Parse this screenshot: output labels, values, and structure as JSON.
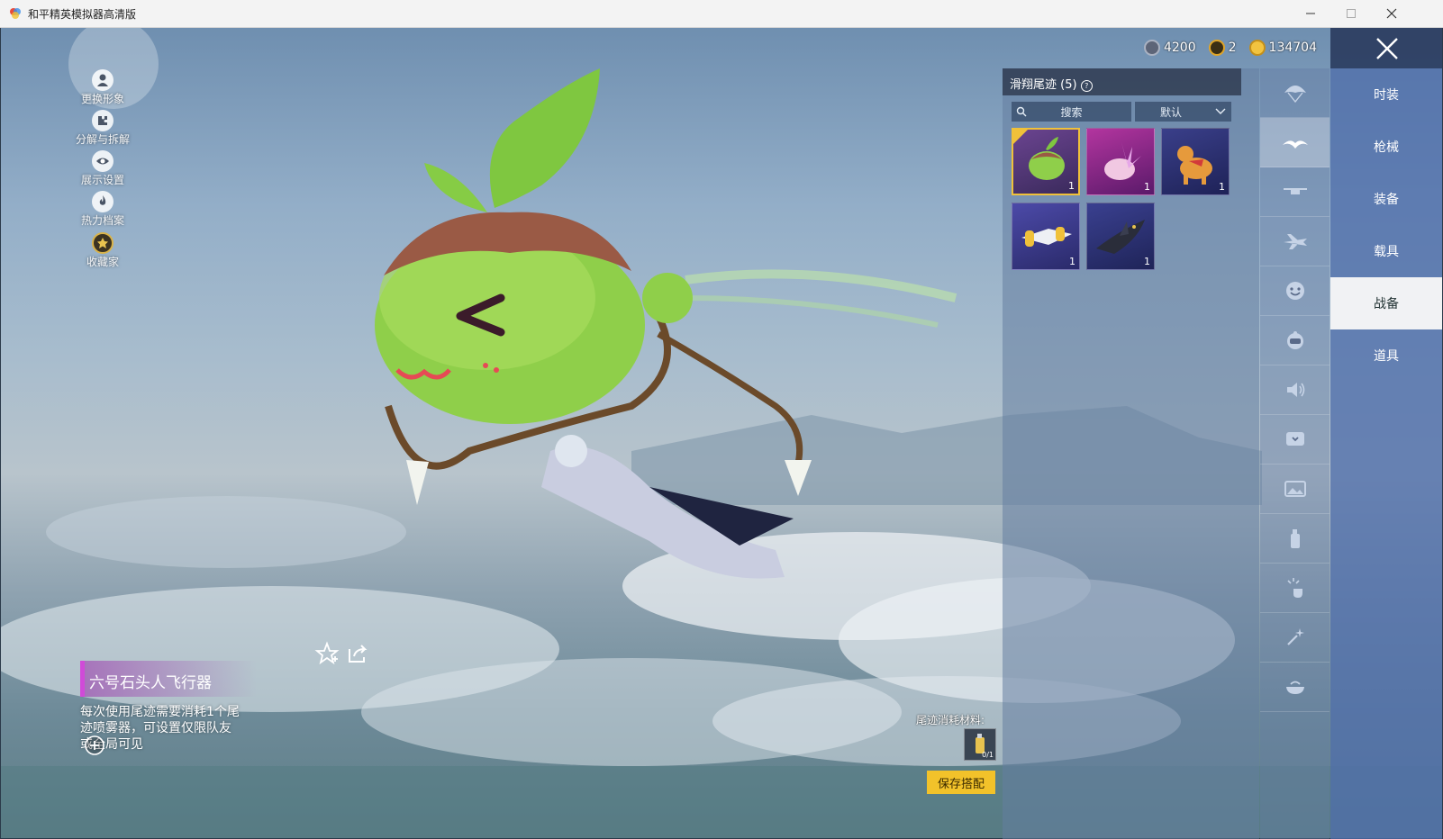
{
  "window": {
    "title": "和平精英模拟器高清版",
    "app_icon": "colorful-app-icon",
    "controls": [
      "minimize-icon",
      "maximize-icon",
      "close-icon"
    ]
  },
  "left_menu": {
    "items": [
      {
        "label": "更换形象",
        "icon": "person-icon"
      },
      {
        "label": "分解与拆解",
        "icon": "puzzle-icon"
      },
      {
        "label": "展示设置",
        "icon": "eye-icon"
      },
      {
        "label": "热力档案",
        "icon": "flame-icon"
      },
      {
        "label": "收藏家",
        "icon": "collector-badge-icon"
      }
    ]
  },
  "currency": [
    {
      "value": "4200",
      "icon": "dark-coin-icon",
      "color": "#8a93a6"
    },
    {
      "value": "2",
      "icon": "gold-badge-coin-icon",
      "color": "#e0a528"
    },
    {
      "value": "134704",
      "icon": "gold-coin-icon",
      "color": "#f2c340"
    }
  ],
  "item": {
    "name": "六号石头人飞行器",
    "description": "每次使用尾迹需要消耗1个尾迹喷雾器，可设置仅限队友或全局可见",
    "accent_color": "#d04ad8"
  },
  "panel": {
    "title": "滑翔尾迹 (5)",
    "search_placeholder": "搜索",
    "sort_label": "默认",
    "tiles": [
      {
        "name": "sprout-glider",
        "count": "1",
        "selected": true,
        "bg": "#4b2e6a"
      },
      {
        "name": "crystal-glider",
        "count": "1",
        "selected": false,
        "bg": "#8b2386"
      },
      {
        "name": "horse-glider",
        "count": "1",
        "selected": false,
        "bg": "#2a2f6e"
      },
      {
        "name": "jet-glider",
        "count": "1",
        "selected": false,
        "bg": "#3e3a8a"
      },
      {
        "name": "shark-glider",
        "count": "1",
        "selected": false,
        "bg": "#2e3470"
      }
    ]
  },
  "tab_icons": [
    {
      "name": "parachute-icon",
      "active": false
    },
    {
      "name": "glider-trail-icon",
      "active": true
    },
    {
      "name": "drone-icon",
      "active": false
    },
    {
      "name": "airplane-icon",
      "active": false
    },
    {
      "name": "emote-face-icon",
      "active": false
    },
    {
      "name": "pet-icon",
      "active": false
    },
    {
      "name": "speaker-icon",
      "active": false
    },
    {
      "name": "message-box-icon",
      "active": false
    },
    {
      "name": "picture-icon",
      "active": false
    },
    {
      "name": "spray-can-icon",
      "active": false
    },
    {
      "name": "tap-effect-icon",
      "active": false
    },
    {
      "name": "sparkle-wand-icon",
      "active": false
    },
    {
      "name": "bowl-icon",
      "active": false
    }
  ],
  "categories": [
    {
      "label": "时装",
      "active": false
    },
    {
      "label": "枪械",
      "active": false
    },
    {
      "label": "装备",
      "active": false
    },
    {
      "label": "载具",
      "active": false
    },
    {
      "label": "战备",
      "active": true
    },
    {
      "label": "道具",
      "active": false
    }
  ],
  "consumable": {
    "label": "尾迹消耗材料:",
    "count": "0/1"
  },
  "save_button": "保存搭配",
  "actions": [
    "favorite-star-icon",
    "share-icon",
    "zoom-in-icon"
  ]
}
